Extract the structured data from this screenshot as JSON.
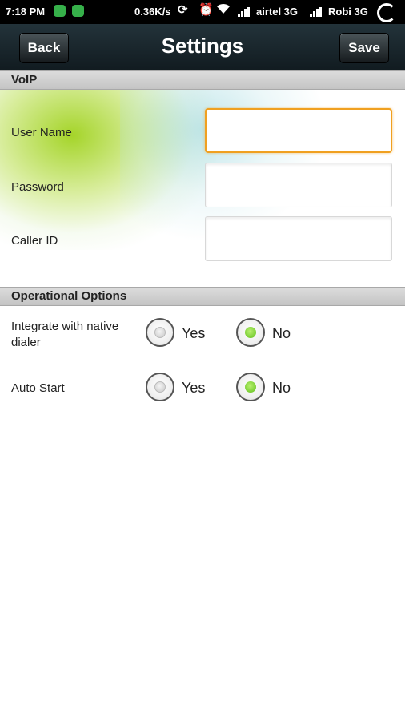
{
  "status_bar": {
    "time": "7:18 PM",
    "network_speed": "0.36K/s",
    "carrier1": "airtel 3G",
    "carrier2": "Robi 3G",
    "icons": [
      "app-notification-icon",
      "leaf-icon",
      "sync-icon",
      "alarm-icon",
      "wifi-icon",
      "signal-icon",
      "battery-icon"
    ]
  },
  "header": {
    "title": "Settings",
    "back_label": "Back",
    "save_label": "Save"
  },
  "voip": {
    "section_title": "VoIP",
    "fields": [
      {
        "label": "User Name",
        "value": "",
        "focused": true
      },
      {
        "label": "Password",
        "value": ""
      },
      {
        "label": "Caller ID",
        "value": ""
      }
    ]
  },
  "options": {
    "section_title": "Operational Options",
    "items": [
      {
        "label": "Integrate with native dialer",
        "yes_label": "Yes",
        "no_label": "No",
        "selected": "No"
      },
      {
        "label": "Auto Start",
        "yes_label": "Yes",
        "no_label": "No",
        "selected": "No"
      }
    ]
  },
  "colors": {
    "title_bar": "#1b272c",
    "focus_border": "#f0a020",
    "radio_selected": "#6cc41f"
  }
}
